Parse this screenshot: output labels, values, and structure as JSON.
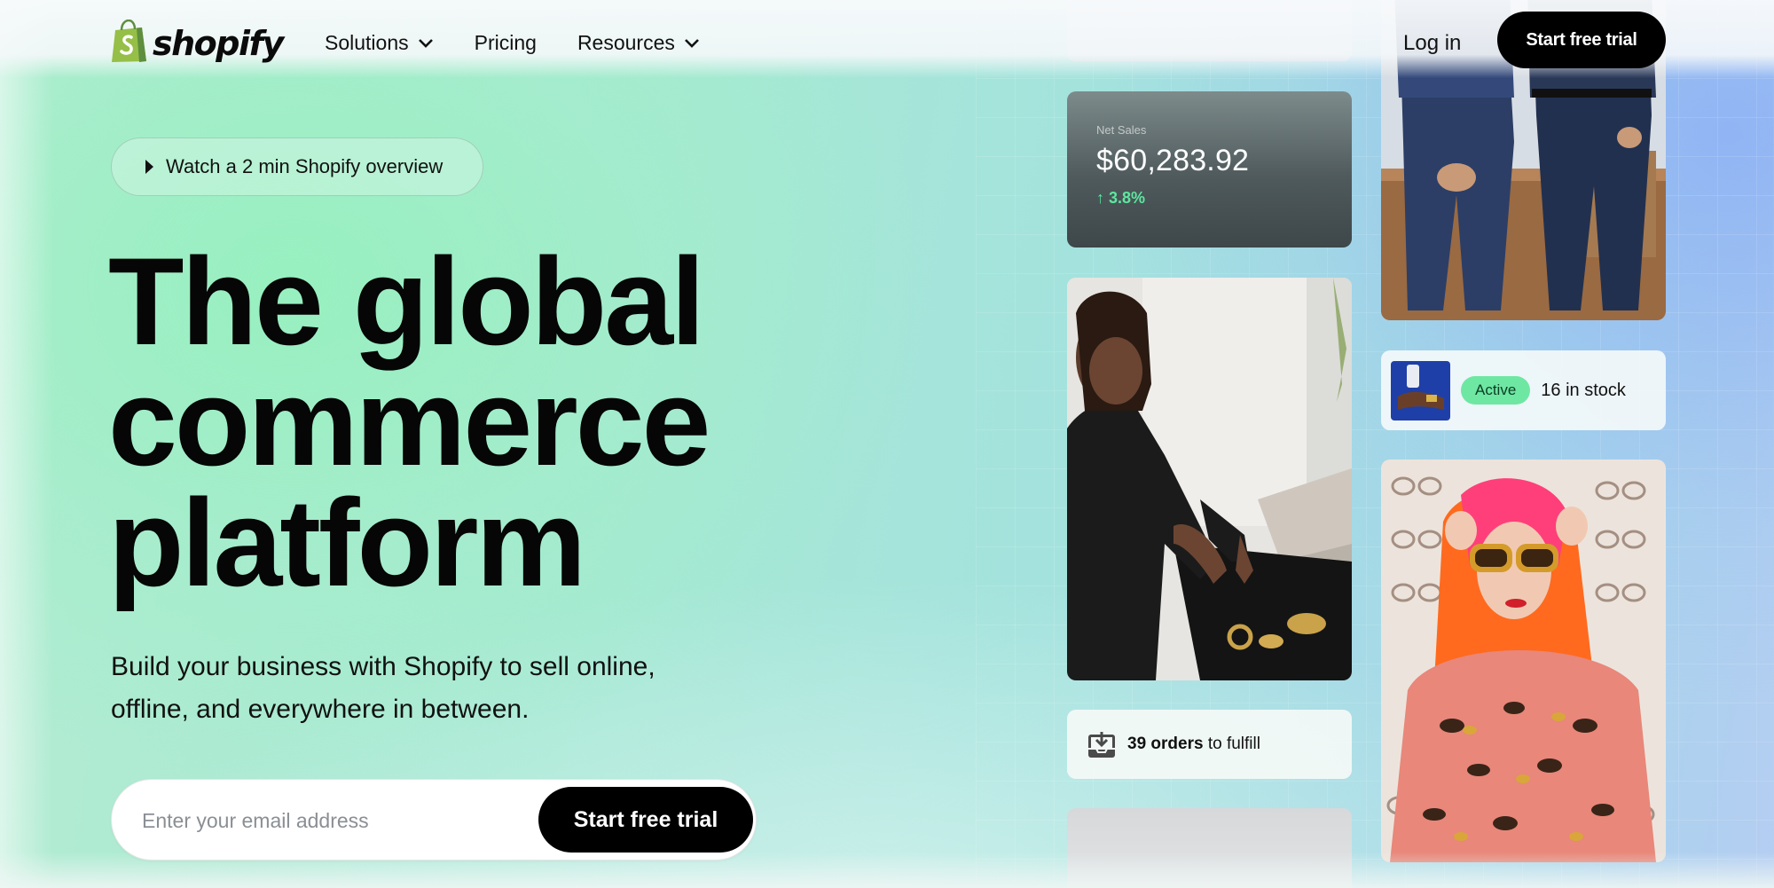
{
  "header": {
    "logo_text": "shopify",
    "nav": [
      {
        "label": "Solutions",
        "has_dropdown": true
      },
      {
        "label": "Pricing",
        "has_dropdown": false
      },
      {
        "label": "Resources",
        "has_dropdown": true
      }
    ],
    "login_label": "Log in",
    "cta_label": "Start free trial"
  },
  "hero": {
    "watch_label": "Watch a 2 min Shopify overview",
    "headline_lines": [
      "The global",
      "commerce",
      "platform"
    ],
    "subtitle_line1": "Build your business with Shopify to sell online,",
    "subtitle_line2": "offline, and everywhere in between.",
    "email_placeholder": "Enter your email address",
    "cta_label": "Start free trial"
  },
  "collage": {
    "sales": {
      "label": "Net Sales",
      "value": "$60,283.92",
      "change": "↑ 3.8%"
    },
    "orders": {
      "count": "39 orders",
      "suffix": "to fulfill"
    },
    "stock": {
      "badge": "Active",
      "text": "16 in stock"
    }
  },
  "colors": {
    "brand_green": "#95bf47",
    "button_black": "#000000",
    "active_badge": "#6ee7a3",
    "positive_change": "#5ee6a0"
  }
}
